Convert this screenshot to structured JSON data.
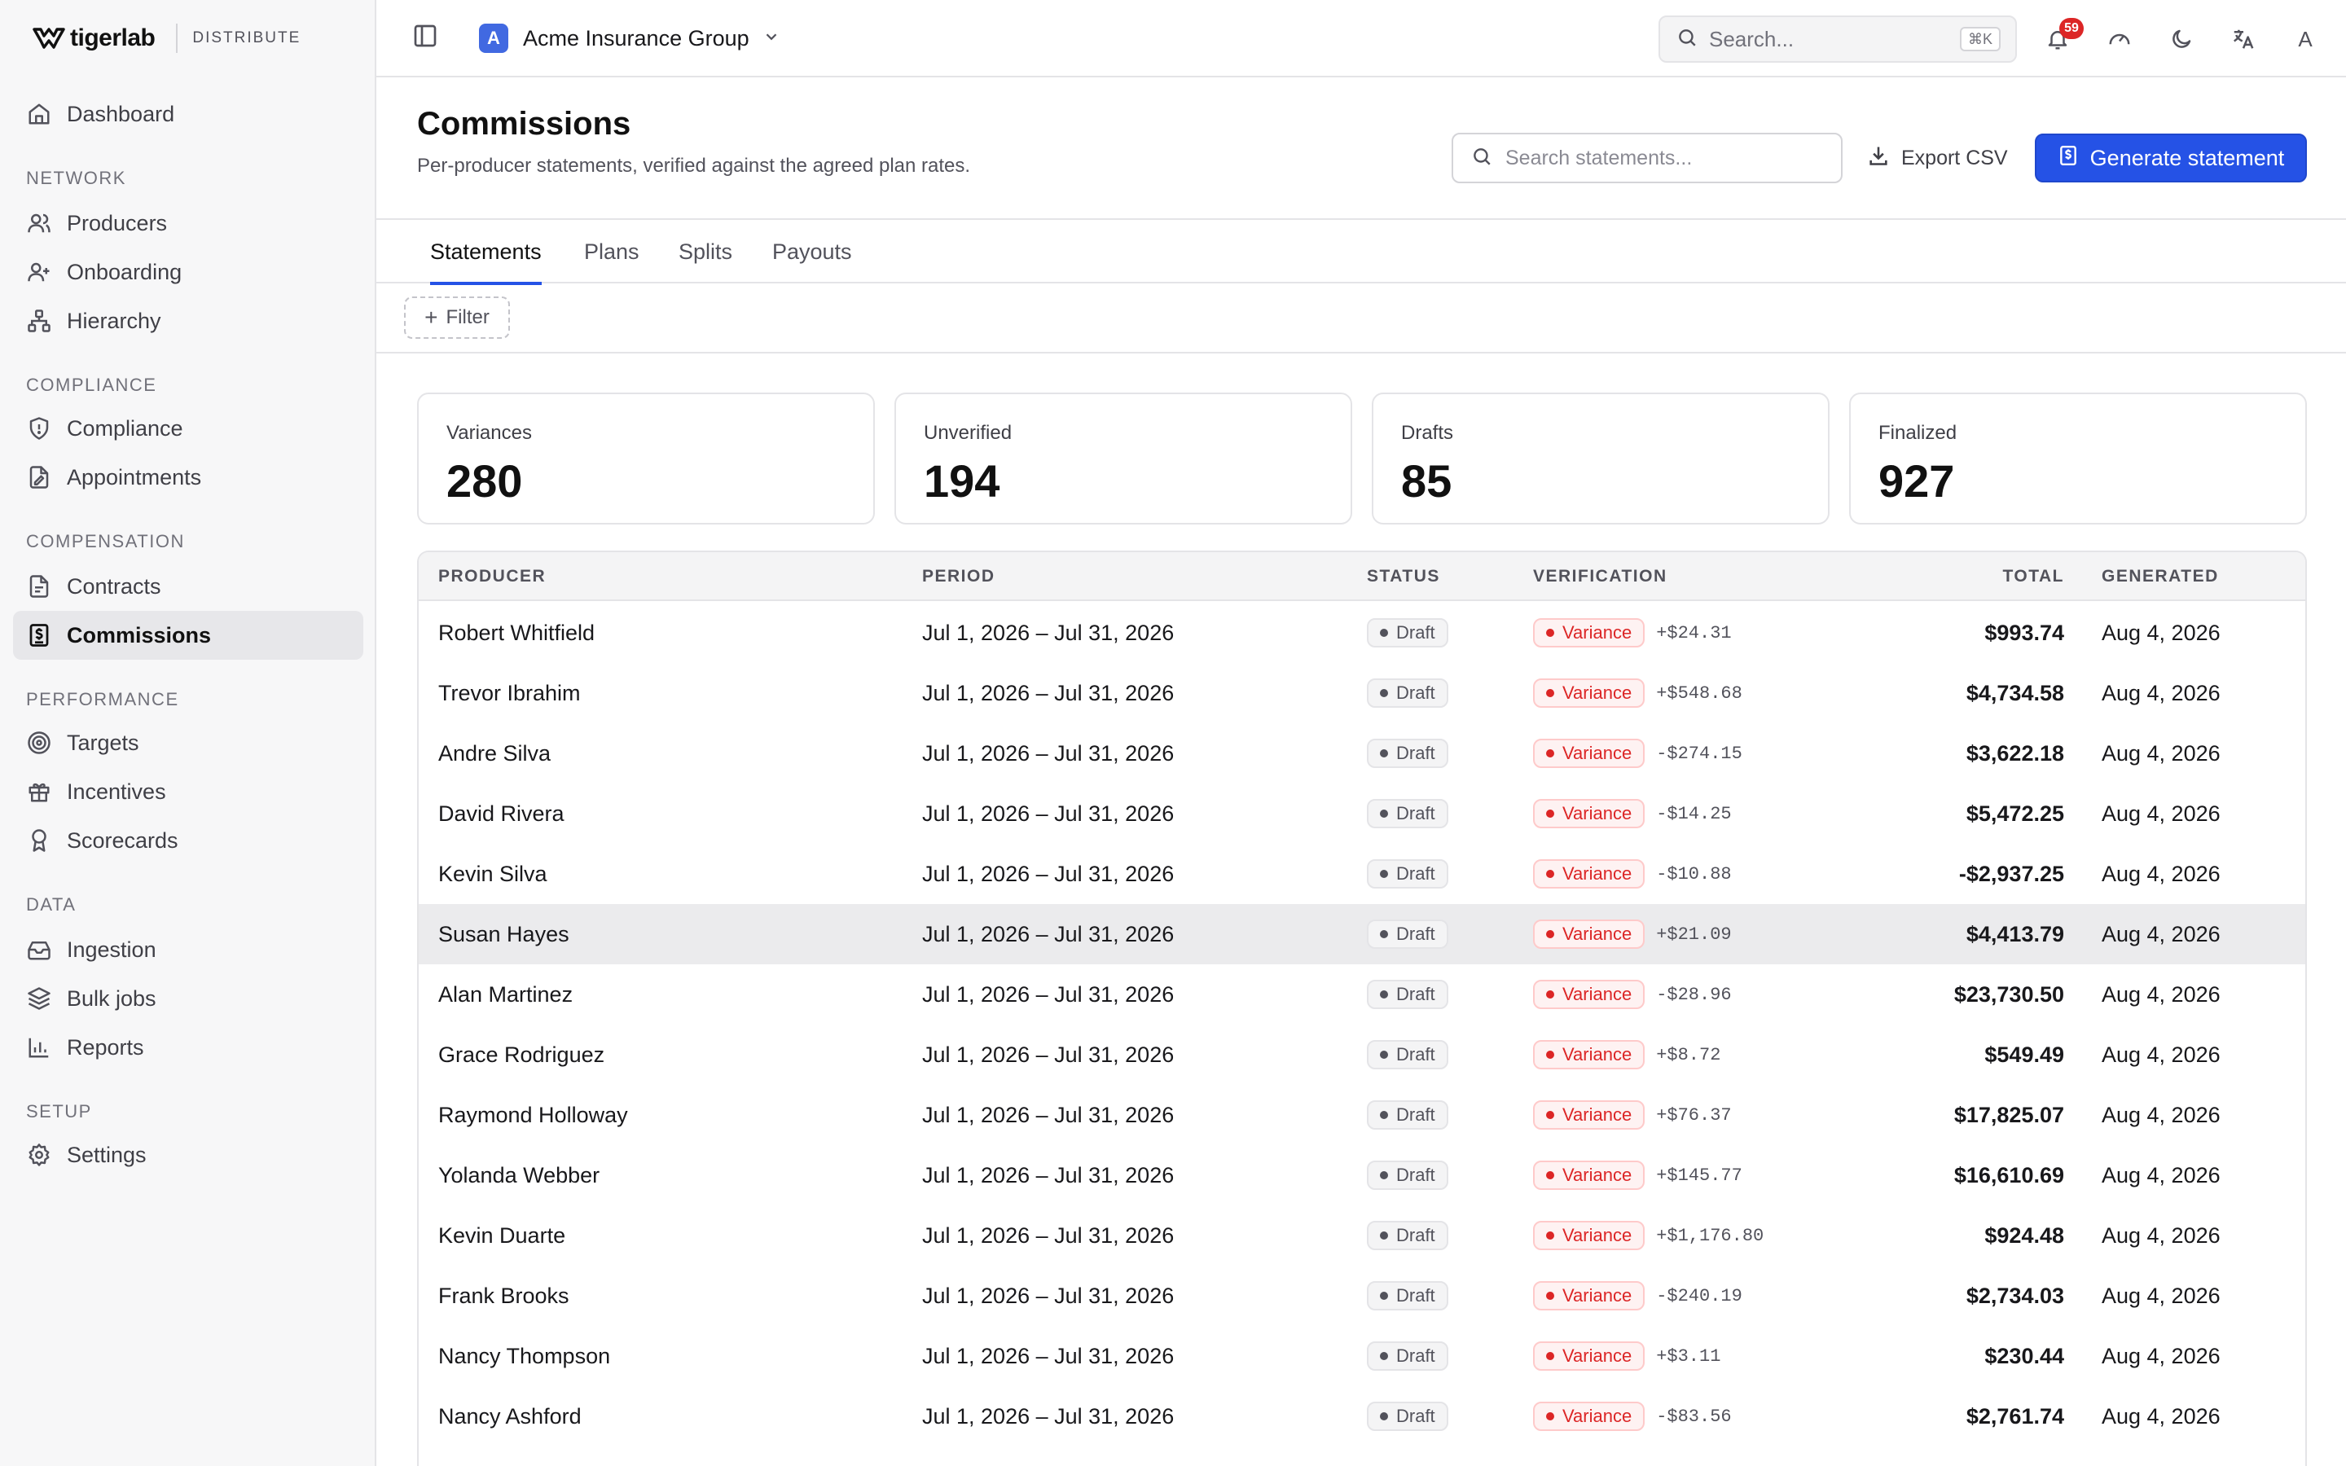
{
  "brand": {
    "name": "tigerlab",
    "product": "DISTRIBUTE"
  },
  "sidebar": {
    "dashboard": "Dashboard",
    "sections": {
      "network": "NETWORK",
      "compliance": "COMPLIANCE",
      "compensation": "COMPENSATION",
      "performance": "PERFORMANCE",
      "data": "DATA",
      "setup": "SETUP"
    },
    "items": {
      "producers": "Producers",
      "onboarding": "Onboarding",
      "hierarchy": "Hierarchy",
      "compliance": "Compliance",
      "appointments": "Appointments",
      "contracts": "Contracts",
      "commissions": "Commissions",
      "targets": "Targets",
      "incentives": "Incentives",
      "scorecards": "Scorecards",
      "ingestion": "Ingestion",
      "bulk_jobs": "Bulk jobs",
      "reports": "Reports",
      "settings": "Settings"
    },
    "active": "commissions"
  },
  "header": {
    "org_initial": "A",
    "org_name": "Acme Insurance Group",
    "search_placeholder": "Search...",
    "search_shortcut": "⌘K",
    "notifications_count": "59",
    "user_initial": "A"
  },
  "page": {
    "title": "Commissions",
    "subtitle": "Per-producer statements, verified against the agreed plan rates.",
    "search_placeholder": "Search statements...",
    "export_label": "Export CSV",
    "generate_label": "Generate statement"
  },
  "tabs": [
    "Statements",
    "Plans",
    "Splits",
    "Payouts"
  ],
  "active_tab": "Statements",
  "filter_label": "Filter",
  "stats": [
    {
      "label": "Variances",
      "value": "280"
    },
    {
      "label": "Unverified",
      "value": "194"
    },
    {
      "label": "Drafts",
      "value": "85"
    },
    {
      "label": "Finalized",
      "value": "927"
    }
  ],
  "table": {
    "columns": {
      "producer": "PRODUCER",
      "period": "PERIOD",
      "status": "STATUS",
      "verification": "VERIFICATION",
      "total": "TOTAL",
      "generated": "GENERATED"
    },
    "rows": [
      {
        "producer": "Robert Whitfield",
        "period": "Jul 1, 2026 – Jul 31, 2026",
        "status": "Draft",
        "verification": "Variance",
        "variance": "+$24.31",
        "total": "$993.74",
        "generated": "Aug 4, 2026"
      },
      {
        "producer": "Trevor Ibrahim",
        "period": "Jul 1, 2026 – Jul 31, 2026",
        "status": "Draft",
        "verification": "Variance",
        "variance": "+$548.68",
        "total": "$4,734.58",
        "generated": "Aug 4, 2026"
      },
      {
        "producer": "Andre Silva",
        "period": "Jul 1, 2026 – Jul 31, 2026",
        "status": "Draft",
        "verification": "Variance",
        "variance": "-$274.15",
        "total": "$3,622.18",
        "generated": "Aug 4, 2026"
      },
      {
        "producer": "David Rivera",
        "period": "Jul 1, 2026 – Jul 31, 2026",
        "status": "Draft",
        "verification": "Variance",
        "variance": "-$14.25",
        "total": "$5,472.25",
        "generated": "Aug 4, 2026"
      },
      {
        "producer": "Kevin Silva",
        "period": "Jul 1, 2026 – Jul 31, 2026",
        "status": "Draft",
        "verification": "Variance",
        "variance": "-$10.88",
        "total": "-$2,937.25",
        "generated": "Aug 4, 2026"
      },
      {
        "producer": "Susan Hayes",
        "period": "Jul 1, 2026 – Jul 31, 2026",
        "status": "Draft",
        "verification": "Variance",
        "variance": "+$21.09",
        "total": "$4,413.79",
        "generated": "Aug 4, 2026",
        "hover": true
      },
      {
        "producer": "Alan Martinez",
        "period": "Jul 1, 2026 – Jul 31, 2026",
        "status": "Draft",
        "verification": "Variance",
        "variance": "-$28.96",
        "total": "$23,730.50",
        "generated": "Aug 4, 2026"
      },
      {
        "producer": "Grace Rodriguez",
        "period": "Jul 1, 2026 – Jul 31, 2026",
        "status": "Draft",
        "verification": "Variance",
        "variance": "+$8.72",
        "total": "$549.49",
        "generated": "Aug 4, 2026"
      },
      {
        "producer": "Raymond Holloway",
        "period": "Jul 1, 2026 – Jul 31, 2026",
        "status": "Draft",
        "verification": "Variance",
        "variance": "+$76.37",
        "total": "$17,825.07",
        "generated": "Aug 4, 2026"
      },
      {
        "producer": "Yolanda Webber",
        "period": "Jul 1, 2026 – Jul 31, 2026",
        "status": "Draft",
        "verification": "Variance",
        "variance": "+$145.77",
        "total": "$16,610.69",
        "generated": "Aug 4, 2026"
      },
      {
        "producer": "Kevin Duarte",
        "period": "Jul 1, 2026 – Jul 31, 2026",
        "status": "Draft",
        "verification": "Variance",
        "variance": "+$1,176.80",
        "total": "$924.48",
        "generated": "Aug 4, 2026"
      },
      {
        "producer": "Frank Brooks",
        "period": "Jul 1, 2026 – Jul 31, 2026",
        "status": "Draft",
        "verification": "Variance",
        "variance": "-$240.19",
        "total": "$2,734.03",
        "generated": "Aug 4, 2026"
      },
      {
        "producer": "Nancy Thompson",
        "period": "Jul 1, 2026 – Jul 31, 2026",
        "status": "Draft",
        "verification": "Variance",
        "variance": "+$3.11",
        "total": "$230.44",
        "generated": "Aug 4, 2026"
      },
      {
        "producer": "Nancy Ashford",
        "period": "Jul 1, 2026 – Jul 31, 2026",
        "status": "Draft",
        "verification": "Variance",
        "variance": "-$83.56",
        "total": "$2,761.74",
        "generated": "Aug 4, 2026"
      }
    ]
  },
  "colors": {
    "accent": "#2552e6",
    "variance": "#dc2626",
    "org_avatar": "#4169e1"
  }
}
